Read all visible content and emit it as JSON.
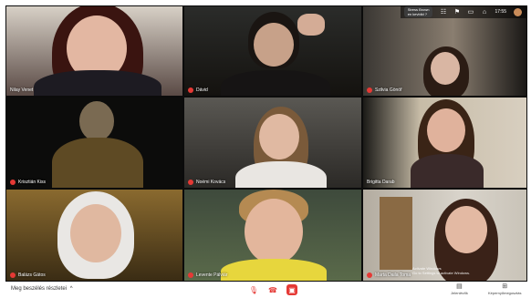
{
  "top_bar": {
    "notification_line1": "Stress Brown",
    "notification_line2": "en kevbild ?",
    "time": "17:55"
  },
  "participants": [
    {
      "name": "Nilay Venet"
    },
    {
      "name": "Dávid"
    },
    {
      "name": "Szilvia Gönöf"
    },
    {
      "name": "Krisztián Kiss"
    },
    {
      "name": "Noémi Kovács"
    },
    {
      "name": "Brigitta Darab"
    },
    {
      "name": "Balázs Gátos"
    },
    {
      "name": "Levente Pálviár"
    },
    {
      "name": "Marta Daila Toma"
    }
  ],
  "overlay_text": {
    "line1": "Activate Windows",
    "line2": "Go to Settings to activate Windows."
  },
  "bottom_bar": {
    "meeting_details": "Meg beszélés részletei",
    "chevron": "^",
    "present_label": "Jelenlévők",
    "share_label": "Képernyőmegosztás",
    "colors": {
      "end_call": "#e53935",
      "mic_off": "#e53935"
    }
  }
}
